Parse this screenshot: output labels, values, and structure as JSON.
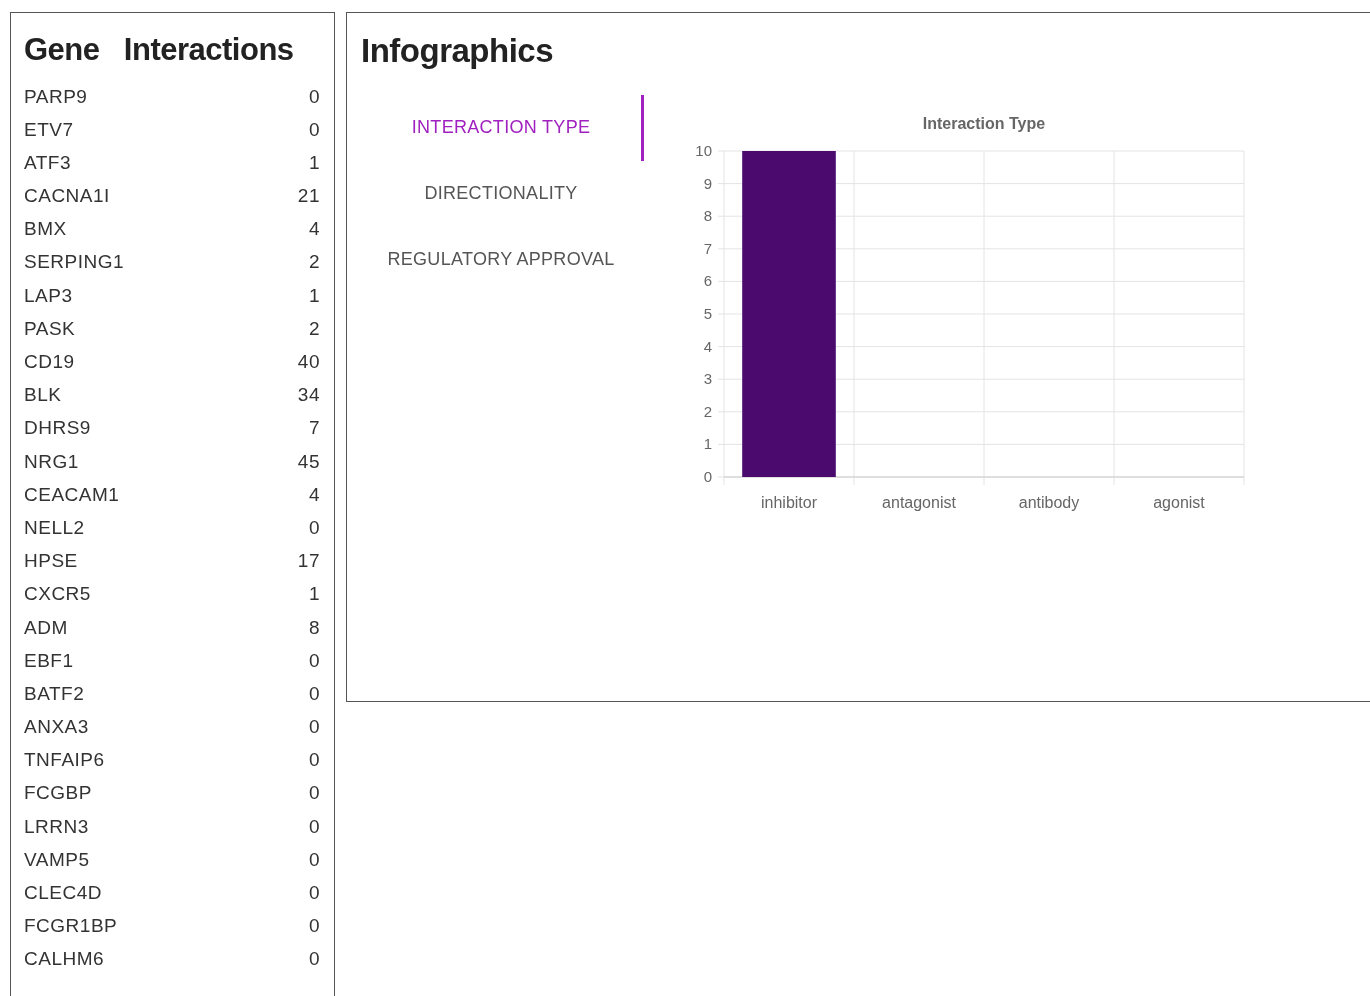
{
  "genes_panel": {
    "title": "Gene   Interactions",
    "rows": [
      {
        "gene": "PARP9",
        "count": "0"
      },
      {
        "gene": "ETV7",
        "count": "0"
      },
      {
        "gene": "ATF3",
        "count": "1"
      },
      {
        "gene": "CACNA1I",
        "count": "21"
      },
      {
        "gene": "BMX",
        "count": "4"
      },
      {
        "gene": "SERPING1",
        "count": "2"
      },
      {
        "gene": "LAP3",
        "count": "1"
      },
      {
        "gene": "PASK",
        "count": "2"
      },
      {
        "gene": "CD19",
        "count": "40"
      },
      {
        "gene": "BLK",
        "count": "34"
      },
      {
        "gene": "DHRS9",
        "count": "7"
      },
      {
        "gene": "NRG1",
        "count": "45"
      },
      {
        "gene": "CEACAM1",
        "count": "4"
      },
      {
        "gene": "NELL2",
        "count": "0"
      },
      {
        "gene": "HPSE",
        "count": "17"
      },
      {
        "gene": "CXCR5",
        "count": "1"
      },
      {
        "gene": "ADM",
        "count": "8"
      },
      {
        "gene": "EBF1",
        "count": "0"
      },
      {
        "gene": "BATF2",
        "count": "0"
      },
      {
        "gene": "ANXA3",
        "count": "0"
      },
      {
        "gene": "TNFAIP6",
        "count": "0"
      },
      {
        "gene": "FCGBP",
        "count": "0"
      },
      {
        "gene": "LRRN3",
        "count": "0"
      },
      {
        "gene": "VAMP5",
        "count": "0"
      },
      {
        "gene": "CLEC4D",
        "count": "0"
      },
      {
        "gene": "FCGR1BP",
        "count": "0"
      },
      {
        "gene": "CALHM6",
        "count": "0"
      }
    ]
  },
  "infographics": {
    "title": "Infographics",
    "tabs": [
      {
        "label": "INTERACTION TYPE",
        "selected": true
      },
      {
        "label": "DIRECTIONALITY",
        "selected": false
      },
      {
        "label": "REGULATORY APPROVAL",
        "selected": false
      }
    ],
    "chart_data": {
      "type": "bar",
      "title": "Interaction Type",
      "categories": [
        "inhibitor",
        "antagonist",
        "antibody",
        "agonist"
      ],
      "series": [
        {
          "color": "#4a0a6e",
          "values": [
            10,
            0,
            0,
            0
          ]
        }
      ],
      "grid": true,
      "ylim": [
        0,
        10
      ],
      "yticks": [
        0,
        1,
        2,
        3,
        4,
        5,
        6,
        7,
        8,
        9,
        10
      ]
    }
  }
}
